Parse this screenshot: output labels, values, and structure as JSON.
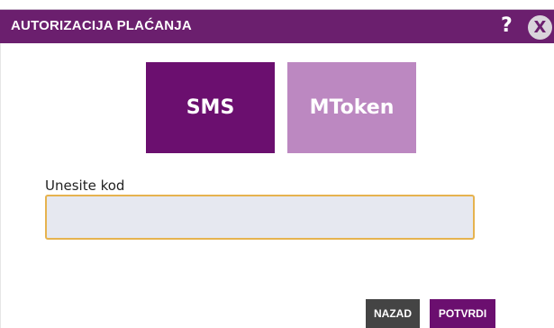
{
  "dialog": {
    "title": "AUTORIZACIJA PLAĆANJA",
    "help_label": "?",
    "close_label": "X"
  },
  "tabs": [
    {
      "label": "SMS",
      "active": true
    },
    {
      "label": "MToken",
      "active": false
    }
  ],
  "code_field": {
    "label": "Unesite kod",
    "value": "",
    "placeholder": ""
  },
  "buttons": {
    "back_label": "NAZAD",
    "confirm_label": "POTVRDI"
  },
  "colors": {
    "primary": "#6b0f6f",
    "header": "#6b1f6e",
    "tab_inactive": "#bc88c1",
    "input_border": "#e6b34f",
    "input_bg": "#e6e8f0",
    "back_button": "#444444"
  },
  "icons": {
    "help": "help-icon",
    "close": "close-icon"
  }
}
